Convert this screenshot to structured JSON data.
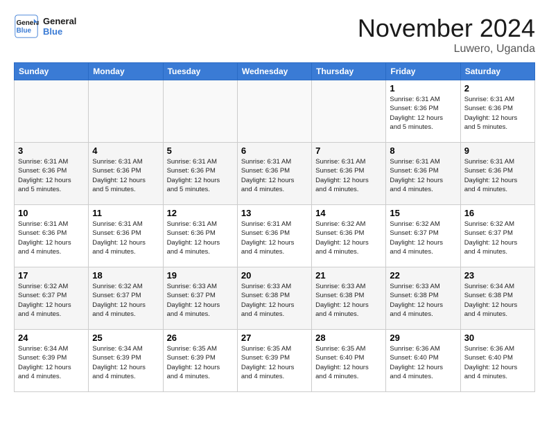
{
  "logo": {
    "line1": "General",
    "line2": "Blue"
  },
  "title": "November 2024",
  "subtitle": "Luwero, Uganda",
  "days_header": [
    "Sunday",
    "Monday",
    "Tuesday",
    "Wednesday",
    "Thursday",
    "Friday",
    "Saturday"
  ],
  "weeks": [
    [
      {
        "day": "",
        "info": ""
      },
      {
        "day": "",
        "info": ""
      },
      {
        "day": "",
        "info": ""
      },
      {
        "day": "",
        "info": ""
      },
      {
        "day": "",
        "info": ""
      },
      {
        "day": "1",
        "info": "Sunrise: 6:31 AM\nSunset: 6:36 PM\nDaylight: 12 hours\nand 5 minutes."
      },
      {
        "day": "2",
        "info": "Sunrise: 6:31 AM\nSunset: 6:36 PM\nDaylight: 12 hours\nand 5 minutes."
      }
    ],
    [
      {
        "day": "3",
        "info": "Sunrise: 6:31 AM\nSunset: 6:36 PM\nDaylight: 12 hours\nand 5 minutes."
      },
      {
        "day": "4",
        "info": "Sunrise: 6:31 AM\nSunset: 6:36 PM\nDaylight: 12 hours\nand 5 minutes."
      },
      {
        "day": "5",
        "info": "Sunrise: 6:31 AM\nSunset: 6:36 PM\nDaylight: 12 hours\nand 5 minutes."
      },
      {
        "day": "6",
        "info": "Sunrise: 6:31 AM\nSunset: 6:36 PM\nDaylight: 12 hours\nand 4 minutes."
      },
      {
        "day": "7",
        "info": "Sunrise: 6:31 AM\nSunset: 6:36 PM\nDaylight: 12 hours\nand 4 minutes."
      },
      {
        "day": "8",
        "info": "Sunrise: 6:31 AM\nSunset: 6:36 PM\nDaylight: 12 hours\nand 4 minutes."
      },
      {
        "day": "9",
        "info": "Sunrise: 6:31 AM\nSunset: 6:36 PM\nDaylight: 12 hours\nand 4 minutes."
      }
    ],
    [
      {
        "day": "10",
        "info": "Sunrise: 6:31 AM\nSunset: 6:36 PM\nDaylight: 12 hours\nand 4 minutes."
      },
      {
        "day": "11",
        "info": "Sunrise: 6:31 AM\nSunset: 6:36 PM\nDaylight: 12 hours\nand 4 minutes."
      },
      {
        "day": "12",
        "info": "Sunrise: 6:31 AM\nSunset: 6:36 PM\nDaylight: 12 hours\nand 4 minutes."
      },
      {
        "day": "13",
        "info": "Sunrise: 6:31 AM\nSunset: 6:36 PM\nDaylight: 12 hours\nand 4 minutes."
      },
      {
        "day": "14",
        "info": "Sunrise: 6:32 AM\nSunset: 6:36 PM\nDaylight: 12 hours\nand 4 minutes."
      },
      {
        "day": "15",
        "info": "Sunrise: 6:32 AM\nSunset: 6:37 PM\nDaylight: 12 hours\nand 4 minutes."
      },
      {
        "day": "16",
        "info": "Sunrise: 6:32 AM\nSunset: 6:37 PM\nDaylight: 12 hours\nand 4 minutes."
      }
    ],
    [
      {
        "day": "17",
        "info": "Sunrise: 6:32 AM\nSunset: 6:37 PM\nDaylight: 12 hours\nand 4 minutes."
      },
      {
        "day": "18",
        "info": "Sunrise: 6:32 AM\nSunset: 6:37 PM\nDaylight: 12 hours\nand 4 minutes."
      },
      {
        "day": "19",
        "info": "Sunrise: 6:33 AM\nSunset: 6:37 PM\nDaylight: 12 hours\nand 4 minutes."
      },
      {
        "day": "20",
        "info": "Sunrise: 6:33 AM\nSunset: 6:38 PM\nDaylight: 12 hours\nand 4 minutes."
      },
      {
        "day": "21",
        "info": "Sunrise: 6:33 AM\nSunset: 6:38 PM\nDaylight: 12 hours\nand 4 minutes."
      },
      {
        "day": "22",
        "info": "Sunrise: 6:33 AM\nSunset: 6:38 PM\nDaylight: 12 hours\nand 4 minutes."
      },
      {
        "day": "23",
        "info": "Sunrise: 6:34 AM\nSunset: 6:38 PM\nDaylight: 12 hours\nand 4 minutes."
      }
    ],
    [
      {
        "day": "24",
        "info": "Sunrise: 6:34 AM\nSunset: 6:39 PM\nDaylight: 12 hours\nand 4 minutes."
      },
      {
        "day": "25",
        "info": "Sunrise: 6:34 AM\nSunset: 6:39 PM\nDaylight: 12 hours\nand 4 minutes."
      },
      {
        "day": "26",
        "info": "Sunrise: 6:35 AM\nSunset: 6:39 PM\nDaylight: 12 hours\nand 4 minutes."
      },
      {
        "day": "27",
        "info": "Sunrise: 6:35 AM\nSunset: 6:39 PM\nDaylight: 12 hours\nand 4 minutes."
      },
      {
        "day": "28",
        "info": "Sunrise: 6:35 AM\nSunset: 6:40 PM\nDaylight: 12 hours\nand 4 minutes."
      },
      {
        "day": "29",
        "info": "Sunrise: 6:36 AM\nSunset: 6:40 PM\nDaylight: 12 hours\nand 4 minutes."
      },
      {
        "day": "30",
        "info": "Sunrise: 6:36 AM\nSunset: 6:40 PM\nDaylight: 12 hours\nand 4 minutes."
      }
    ]
  ]
}
